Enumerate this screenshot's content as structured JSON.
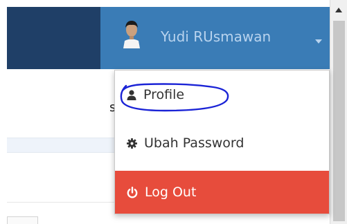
{
  "header": {
    "username": "Yudi RUsmawan"
  },
  "user_menu": {
    "items": [
      {
        "label": "Profile",
        "icon": "user-icon"
      },
      {
        "label": "Ubah Password",
        "icon": "gear-icon"
      },
      {
        "label": "Log Out",
        "icon": "power-icon"
      }
    ]
  },
  "page": {
    "partial_letter": "s"
  },
  "colors": {
    "header_dark": "#1f3f67",
    "header_blue": "#3a7cb6",
    "logout_red": "#e74c3c",
    "annotation_blue": "#1a23d6"
  }
}
